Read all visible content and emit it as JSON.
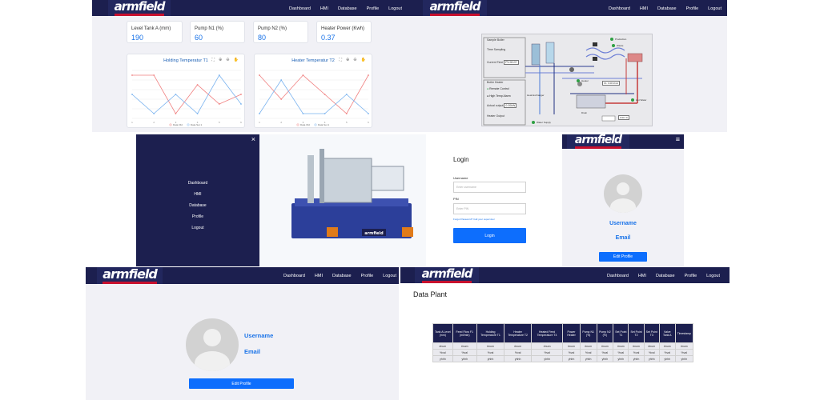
{
  "brand": {
    "logo": "armfield",
    "accent": "#c8102e",
    "navy": "#1c1f4f"
  },
  "nav": {
    "dashboard": "Dashboard",
    "hmi": "HMI",
    "database": "Database",
    "profile": "Profile",
    "logout": "Logout"
  },
  "dashboard": {
    "cards": [
      {
        "label": "Level Tank A (mm)",
        "value": "190"
      },
      {
        "label": "Pump N1 (%)",
        "value": "60"
      },
      {
        "label": "Pump N2 (%)",
        "value": "80"
      },
      {
        "label": "Heater Power (Kwh)",
        "value": "0.37"
      }
    ]
  },
  "chart_data": [
    {
      "type": "line",
      "title": "Holding Temperatur T1",
      "x": [
        1,
        2,
        3,
        4,
        5,
        6
      ],
      "series": [
        {
          "name": "Data Old",
          "color": "#f08080",
          "values": [
            9,
            9,
            1,
            7,
            3,
            5
          ]
        },
        {
          "name": "Data Set 1",
          "color": "#7ab3ef",
          "values": [
            5,
            1,
            5,
            1,
            9,
            3
          ]
        }
      ],
      "ylim": [
        0,
        10
      ]
    },
    {
      "type": "line",
      "title": "Heater Temperatur T2",
      "x": [
        1,
        2,
        3,
        4,
        5,
        6
      ],
      "series": [
        {
          "name": "Data Old",
          "color": "#f08080",
          "values": [
            9,
            4,
            9,
            5,
            1,
            9
          ]
        },
        {
          "name": "Data Set 1",
          "color": "#7ab3ef",
          "values": [
            1,
            8,
            1,
            1,
            5,
            1
          ]
        }
      ],
      "ylim": [
        0,
        10
      ]
    }
  ],
  "hmi": {
    "sample_boiler": "Sample Boiler",
    "time_sampling": "Time Sampling",
    "current_time": "Current Time",
    "current_time_value": "PV:00:07",
    "boiler_heater": "Boiler Heater",
    "remote_control": "Remote Control",
    "high_temp_alarm": "High Temp Alarm",
    "actual_output": "Actual output",
    "actual_output_value": "0.00kW",
    "heater_output": "Heater Output",
    "production": "Production",
    "waste": "Waste",
    "heater": "Heater",
    "heat_exchanger": "Heat Exchanger",
    "drain": "Drain",
    "water_supply": "Water Supply",
    "hot_water": "Hot Water",
    "f1": "F1: 0.00 l/min",
    "t_reading": "0.00 °C"
  },
  "login": {
    "title": "Login",
    "username_label": "Username",
    "username_placeholder": "Enter username",
    "pin_label": "PIN",
    "pin_placeholder": "Enter PIN",
    "forgot": "Forgot Password? Call your supervisor",
    "button": "Login"
  },
  "profile": {
    "username": "Username",
    "email": "Email",
    "edit": "Edit Profile"
  },
  "data_plant": {
    "title": "Data Plant",
    "headers": [
      "Tank A Level (mm)",
      "Feed Flow F1 (ml/min)",
      "Holding Temperature T1",
      "Heater Temperature T2",
      "Heated Feed Temperature T4",
      "Power Heater",
      "Pump N1 (%)",
      "Pump N2 (%)",
      "Set Point T1",
      "Set Point T2",
      "Set Point T3",
      "Valve Tank A",
      "Timestamp"
    ],
    "rows": [
      [
        "#num",
        "#num",
        "#num",
        "#num",
        "#num",
        "#num",
        "#num",
        "#num",
        "#num",
        "#num",
        "#num",
        "#num",
        "#num"
      ],
      [
        "%val",
        "%val",
        "%val",
        "%val",
        "%val",
        "%val",
        "%val",
        "%val",
        "%val",
        "%val",
        "%val",
        "%val",
        "%val"
      ],
      [
        "yhhh",
        "yhhh",
        "yhhh",
        "yhhh",
        "yhhh",
        "yhhh",
        "yhhh",
        "yhhh",
        "yhhh",
        "yhhh",
        "yhhh",
        "yhhh",
        "yhhh"
      ]
    ]
  },
  "sidebar": {
    "close": "×",
    "items": [
      "Dashboard",
      "HMI",
      "Database",
      "Profile",
      "Logout"
    ]
  },
  "hamburger": "≡"
}
